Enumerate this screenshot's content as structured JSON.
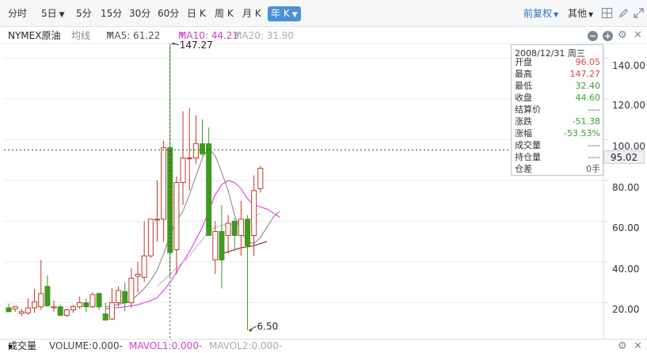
{
  "toolbar": {
    "periods": [
      {
        "label": "分时",
        "active": false
      },
      {
        "label": "5日",
        "active": false,
        "dropdown": true
      },
      {
        "label": "5分",
        "active": false
      },
      {
        "label": "15分",
        "active": false
      },
      {
        "label": "30分",
        "active": false
      },
      {
        "label": "60分",
        "active": false
      },
      {
        "label": "日 K",
        "active": false
      },
      {
        "label": "周 K",
        "active": false
      },
      {
        "label": "月 K",
        "active": false
      },
      {
        "label": "年 K",
        "active": true,
        "dropdown": true
      }
    ],
    "adjust_label": "前复权",
    "other_label": "其他",
    "icons": [
      "grid-icon",
      "edit-icon",
      "expand-icon"
    ]
  },
  "legend": {
    "symbol": "NYMEX原油",
    "type_label": "均线",
    "ma5": "MA5: 61.22",
    "ma10": "MA10: 44.21",
    "ma20": "MA20: 31.90",
    "arrow": "↑",
    "icons": [
      "minus-icon",
      "plus-icon",
      "gear-icon",
      "close-icon"
    ]
  },
  "info": {
    "date": "2008/12/31 周三",
    "rows": [
      {
        "label": "开盘",
        "value": "96.05",
        "color": "red"
      },
      {
        "label": "最高",
        "value": "147.27",
        "color": "red"
      },
      {
        "label": "最低",
        "value": "32.40",
        "color": "green"
      },
      {
        "label": "收盘",
        "value": "44.60",
        "color": "green"
      },
      {
        "label": "结算价",
        "value": "----",
        "color": "gray"
      },
      {
        "label": "涨跌",
        "value": "-51.38",
        "color": "green"
      },
      {
        "label": "涨幅",
        "value": "-53.53%",
        "color": "green"
      },
      {
        "label": "成交量",
        "value": "----",
        "color": "gray"
      },
      {
        "label": "持仓量",
        "value": "----",
        "color": "gray"
      },
      {
        "label": "仓差",
        "value": "0手",
        "color": "gray"
      }
    ]
  },
  "crosshair_price": "95.02",
  "volume_bar": {
    "label": "成交量",
    "volume": "VOLUME:0.000-",
    "mavol1": "MAVOL1:0.000-",
    "mavol2": "MAVOL2:0.000-"
  },
  "colors": {
    "up": "#c0392b",
    "down": "#3f9a1d",
    "ma5": "#8c8c8c",
    "ma10": "#dd3fdd",
    "ma20": "#bbbbbb",
    "ma40": "#8b1a1a",
    "accent": "#4a90d9",
    "grid": "#e8ebef"
  },
  "chart_data": {
    "type": "candlestick",
    "yaxis": {
      "ticks": [
        20,
        40,
        60,
        80,
        100,
        120,
        140
      ],
      "tick_labels": [
        "20.00",
        "40.00",
        "60.00",
        "80.00",
        "100.00",
        "120.00",
        "140.00"
      ],
      "ylim": [
        7,
        157
      ]
    },
    "annotations": [
      {
        "label": "147.27",
        "value": 147.27
      },
      {
        "label": "6.50",
        "value": 6.5
      }
    ],
    "crosshair_value": 95.02,
    "crosshair_index": 30,
    "candles": [
      {
        "o": 17.5,
        "h": 19.5,
        "l": 15.5,
        "c": 15.6
      },
      {
        "o": 17.0,
        "h": 18.5,
        "l": 15.5,
        "c": 18.0
      },
      {
        "o": 14.8,
        "h": 17.0,
        "l": 13.5,
        "c": 15.6
      },
      {
        "o": 15.0,
        "h": 22.0,
        "l": 14.2,
        "c": 17.5
      },
      {
        "o": 17.5,
        "h": 27.0,
        "l": 15.0,
        "c": 20.5
      },
      {
        "o": 18.0,
        "h": 41.0,
        "l": 16.5,
        "c": 24.5
      },
      {
        "o": 28.0,
        "h": 33.5,
        "l": 18.0,
        "c": 18.5
      },
      {
        "o": 17.5,
        "h": 21.0,
        "l": 15.5,
        "c": 18.0
      },
      {
        "o": 18.0,
        "h": 19.0,
        "l": 13.5,
        "c": 13.8
      },
      {
        "o": 13.8,
        "h": 17.0,
        "l": 13.0,
        "c": 16.5
      },
      {
        "o": 16.5,
        "h": 19.0,
        "l": 15.0,
        "c": 18.0
      },
      {
        "o": 18.0,
        "h": 23.0,
        "l": 17.0,
        "c": 20.0
      },
      {
        "o": 20.0,
        "h": 22.0,
        "l": 15.5,
        "c": 18.0
      },
      {
        "o": 18.0,
        "h": 25.0,
        "l": 17.5,
        "c": 24.0
      },
      {
        "o": 24.5,
        "h": 25.0,
        "l": 16.5,
        "c": 18.0
      },
      {
        "o": 14.5,
        "h": 20.0,
        "l": 13.0,
        "c": 11.5
      },
      {
        "o": 12.0,
        "h": 27.0,
        "l": 11.5,
        "c": 20.0
      },
      {
        "o": 20.0,
        "h": 28.0,
        "l": 18.0,
        "c": 26.0
      },
      {
        "o": 25.5,
        "h": 30.0,
        "l": 16.0,
        "c": 20.0
      },
      {
        "o": 20.0,
        "h": 37.0,
        "l": 17.5,
        "c": 32.0
      },
      {
        "o": 33.0,
        "h": 40.0,
        "l": 25.0,
        "c": 34.0
      },
      {
        "o": 32.5,
        "h": 60.0,
        "l": 30.0,
        "c": 43.0
      },
      {
        "o": 43.0,
        "h": 61.0,
        "l": 42.0,
        "c": 61.0
      },
      {
        "o": 61.0,
        "h": 80.0,
        "l": 50.0,
        "c": 61.0
      },
      {
        "o": 61.0,
        "h": 99.5,
        "l": 50.0,
        "c": 96.0
      },
      {
        "o": 96.05,
        "h": 147.27,
        "l": 32.4,
        "c": 44.6
      },
      {
        "o": 46.0,
        "h": 82.0,
        "l": 34.0,
        "c": 79.0
      },
      {
        "o": 79.0,
        "h": 114.0,
        "l": 68.0,
        "c": 91.0
      },
      {
        "o": 91.0,
        "h": 115.5,
        "l": 75.0,
        "c": 91.0
      },
      {
        "o": 91.0,
        "h": 112.0,
        "l": 88.0,
        "c": 98.0
      },
      {
        "o": 98.0,
        "h": 110.0,
        "l": 92.0,
        "c": 93.0
      },
      {
        "o": 98.0,
        "h": 106.0,
        "l": 70.0,
        "c": 53.0
      },
      {
        "o": 41.0,
        "h": 60.0,
        "l": 34.0,
        "c": 55.0
      },
      {
        "o": 55.0,
        "h": 68.0,
        "l": 27.0,
        "c": 41.0
      },
      {
        "o": 53.0,
        "h": 63.0,
        "l": 44.0,
        "c": 59.0
      },
      {
        "o": 60.0,
        "h": 61.5,
        "l": 46.0,
        "c": 53.0
      },
      {
        "o": 53.0,
        "h": 70.0,
        "l": 43.0,
        "c": 61.0
      },
      {
        "o": 61.0,
        "h": 63.0,
        "l": 6.5,
        "c": 48.0
      },
      {
        "o": 53.0,
        "h": 82.5,
        "l": 43.0,
        "c": 75.0
      },
      {
        "o": 76.0,
        "h": 87.0,
        "l": 74.0,
        "c": 86.0
      }
    ],
    "ma_lines": [
      {
        "name": "MA5",
        "color": "#8c8c8c",
        "start": 15,
        "values": [
          18.0,
          18.5,
          19.2,
          19.8,
          21.0,
          24.0,
          27.0,
          31.0,
          36.0,
          44.0,
          53.0,
          60.0,
          65.0,
          73.0,
          82.0,
          91.0,
          96.0,
          92.0,
          84.0,
          75.0,
          63.0,
          55.0,
          50.0,
          49.0,
          52.0,
          57.0,
          62.0,
          65.0
        ]
      },
      {
        "name": "MA10",
        "color": "#dd3fdd",
        "start": 15,
        "values": [
          17.0,
          17.3,
          17.6,
          18.0,
          18.5,
          19.0,
          20.0,
          21.0,
          22.5,
          26.0,
          30.0,
          35.0,
          40.0,
          45.0,
          51.0,
          57.0,
          65.0,
          73.0,
          78.0,
          80.0,
          79.0,
          76.0,
          71.0,
          68.0,
          67.0,
          66.0,
          64.0,
          62.0
        ]
      },
      {
        "name": "MA20",
        "color": "#bbbbbb",
        "start": 23,
        "values": [
          28.0,
          31.0,
          34.0,
          37.0,
          40.0,
          43.0,
          47.0,
          51.0,
          55.0,
          57.0,
          58.0,
          58.5,
          58.5,
          59.0,
          60.0,
          62.0,
          64.0
        ]
      },
      {
        "name": "MA40",
        "color": "#8b1a1a",
        "start": 33,
        "values": [
          44.0,
          45.0,
          46.0,
          47.0,
          47.5,
          48.0,
          49.0,
          50.0
        ]
      }
    ]
  }
}
